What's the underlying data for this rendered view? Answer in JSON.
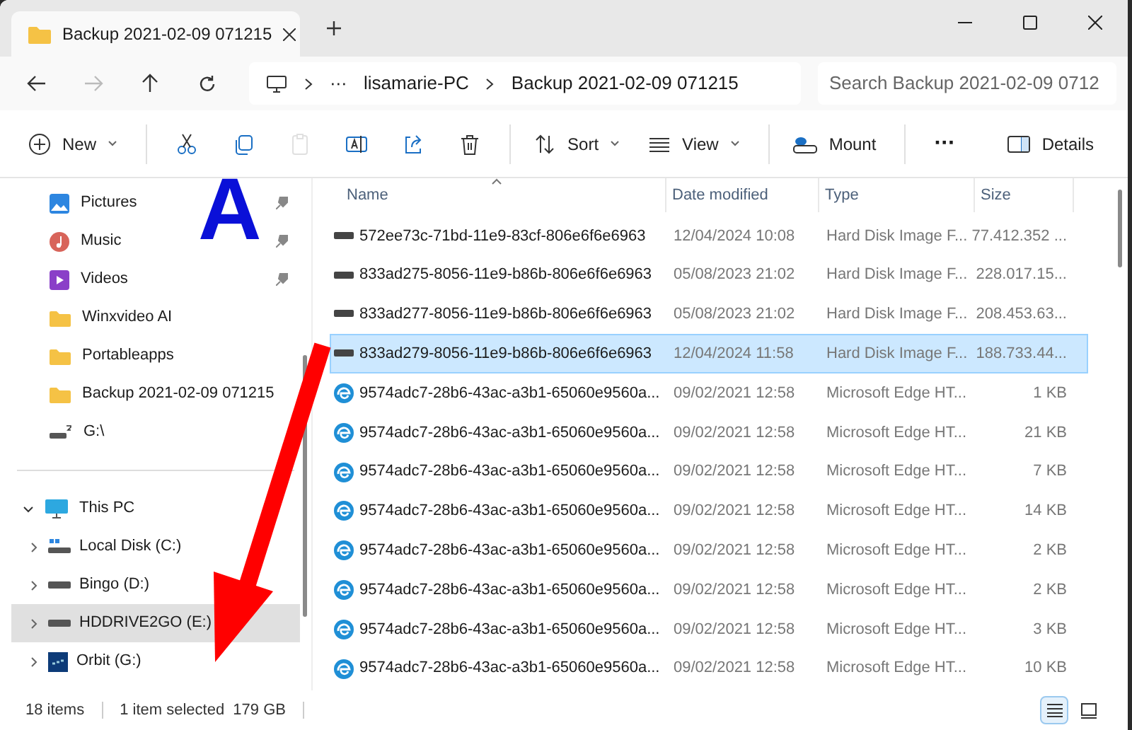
{
  "tabs": [
    {
      "title": "Backup 2021-02-09 071215",
      "selected": true
    }
  ],
  "address": {
    "ellipsis": "···",
    "crumbs": [
      "lisamarie-PC",
      "Backup 2021-02-09 071215"
    ],
    "search_placeholder": "Search Backup 2021-02-09 0712"
  },
  "toolbar": [
    {
      "kind": "menu",
      "label": "New"
    },
    {
      "kind": "sep"
    },
    {
      "kind": "icon",
      "disabled": false
    },
    {
      "kind": "icon",
      "disabled": false
    },
    {
      "kind": "icon",
      "disabled": true
    },
    {
      "kind": "icon",
      "disabled": false
    },
    {
      "kind": "icon",
      "disabled": false
    },
    {
      "kind": "icon",
      "disabled": false
    },
    {
      "kind": "sep"
    },
    {
      "kind": "menu",
      "label": "Sort"
    },
    {
      "kind": "menu",
      "label": "View"
    },
    {
      "kind": "sep"
    },
    {
      "kind": "button",
      "label": "Mount"
    },
    {
      "kind": "sep"
    },
    {
      "kind": "more",
      "label": "···"
    },
    {
      "kind": "spacer"
    },
    {
      "kind": "button",
      "label": "Details"
    }
  ],
  "sidebar": {
    "quick_access": [
      {
        "label": "Pictures",
        "kind": "pictures",
        "pinned": true
      },
      {
        "label": "Music",
        "kind": "music",
        "pinned": true
      },
      {
        "label": "Videos",
        "kind": "videos",
        "pinned": true
      },
      {
        "label": "Winxvideo AI",
        "kind": "folder",
        "pinned": false
      },
      {
        "label": "Portableapps",
        "kind": "folder",
        "pinned": false
      },
      {
        "label": "Backup 2021-02-09 071215",
        "kind": "folder",
        "pinned": false
      },
      {
        "label": "G:\\",
        "kind": "netdrive",
        "pinned": false
      }
    ],
    "this_pc": {
      "label": "This PC",
      "expanded": true,
      "children": [
        {
          "label": "Local Disk (C:)",
          "kind": "windrive",
          "selected": false,
          "expanded": false
        },
        {
          "label": "Bingo (D:)",
          "kind": "drive",
          "selected": false,
          "expanded": false
        },
        {
          "label": "HDDRIVE2GO (E:)",
          "kind": "drive",
          "selected": true,
          "expanded": false
        },
        {
          "label": "Orbit (G:)",
          "kind": "orbit",
          "selected": false,
          "expanded": false
        }
      ]
    }
  },
  "table": {
    "columns": [
      "Name",
      "Date modified",
      "Type",
      "Size"
    ],
    "rows": [
      {
        "name": "572ee73c-71bd-11e9-83cf-806e6f6e6963",
        "date": "12/04/2024 10:08",
        "type": "Hard Disk Image F...",
        "size": "77.412.352 ...",
        "kind": "disk",
        "selected": false
      },
      {
        "name": "833ad275-8056-11e9-b86b-806e6f6e6963",
        "date": "05/08/2023 21:02",
        "type": "Hard Disk Image F...",
        "size": "228.017.15...",
        "kind": "disk",
        "selected": false
      },
      {
        "name": "833ad277-8056-11e9-b86b-806e6f6e6963",
        "date": "05/08/2023 21:02",
        "type": "Hard Disk Image F...",
        "size": "208.453.63...",
        "kind": "disk",
        "selected": false
      },
      {
        "name": "833ad279-8056-11e9-b86b-806e6f6e6963",
        "date": "12/04/2024 11:58",
        "type": "Hard Disk Image F...",
        "size": "188.733.44...",
        "kind": "disk",
        "selected": true
      },
      {
        "name": "9574adc7-28b6-43ac-a3b1-65060e9560a...",
        "date": "09/02/2021 12:58",
        "type": "Microsoft Edge HT...",
        "size": "1 KB",
        "kind": "html",
        "selected": false
      },
      {
        "name": "9574adc7-28b6-43ac-a3b1-65060e9560a...",
        "date": "09/02/2021 12:58",
        "type": "Microsoft Edge HT...",
        "size": "21 KB",
        "kind": "html",
        "selected": false
      },
      {
        "name": "9574adc7-28b6-43ac-a3b1-65060e9560a...",
        "date": "09/02/2021 12:58",
        "type": "Microsoft Edge HT...",
        "size": "7 KB",
        "kind": "html",
        "selected": false
      },
      {
        "name": "9574adc7-28b6-43ac-a3b1-65060e9560a...",
        "date": "09/02/2021 12:58",
        "type": "Microsoft Edge HT...",
        "size": "14 KB",
        "kind": "html",
        "selected": false
      },
      {
        "name": "9574adc7-28b6-43ac-a3b1-65060e9560a...",
        "date": "09/02/2021 12:58",
        "type": "Microsoft Edge HT...",
        "size": "2 KB",
        "kind": "html",
        "selected": false
      },
      {
        "name": "9574adc7-28b6-43ac-a3b1-65060e9560a...",
        "date": "09/02/2021 12:58",
        "type": "Microsoft Edge HT...",
        "size": "2 KB",
        "kind": "html",
        "selected": false
      },
      {
        "name": "9574adc7-28b6-43ac-a3b1-65060e9560a...",
        "date": "09/02/2021 12:58",
        "type": "Microsoft Edge HT...",
        "size": "3 KB",
        "kind": "html",
        "selected": false
      },
      {
        "name": "9574adc7-28b6-43ac-a3b1-65060e9560a...",
        "date": "09/02/2021 12:58",
        "type": "Microsoft Edge HT...",
        "size": "10 KB",
        "kind": "html",
        "selected": false
      }
    ]
  },
  "status_bar": {
    "items": "18 items",
    "selection": "1 item selected  179 GB",
    "view_buttons": [
      {
        "selected": true
      },
      {
        "selected": false
      }
    ]
  },
  "annotation": {
    "letter": "A"
  }
}
